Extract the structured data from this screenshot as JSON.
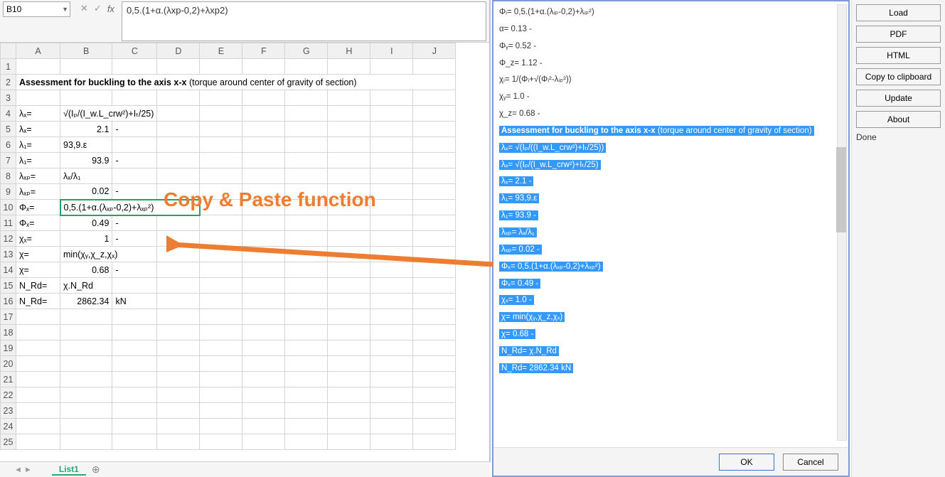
{
  "formula_bar": {
    "name_box": "B10",
    "cancel": "✕",
    "accept": "✓",
    "fx": "fx",
    "formula": "0,5.(1+α.(λxp-0,2)+λxp2)"
  },
  "columns": [
    "A",
    "B",
    "C",
    "D",
    "E",
    "F",
    "G",
    "H",
    "I",
    "J"
  ],
  "rows": {
    "r2": {
      "a": "Assessment for buckling to the axis x-x",
      "a2": " (torque around center of gravity of section)"
    },
    "r4": {
      "a": "λₓ=",
      "b": "√(Iₚ/(I_w.L_crw²)+Iₜ/25)"
    },
    "r5": {
      "a": "λₓ=",
      "b": "2.1",
      "c": "-"
    },
    "r6": {
      "a": "λ₁=",
      "b": "93,9.ε"
    },
    "r7": {
      "a": "λ₁=",
      "b": "93.9",
      "c": "-"
    },
    "r8": {
      "a": "λₓₚ=",
      "b": "λₓ/λ₁"
    },
    "r9": {
      "a": "λₓₚ=",
      "b": "0.02",
      "c": "-"
    },
    "r10": {
      "a": "Φₓ=",
      "b": "0,5.(1+α.(λₓₚ-0,2)+λₓₚ²)"
    },
    "r11": {
      "a": "Φₓ=",
      "b": "0.49",
      "c": "-"
    },
    "r12": {
      "a": "χₓ=",
      "b": "1",
      "c": "-"
    },
    "r13": {
      "a": "χ=",
      "b": "min(χᵧ,χ_z,χₓ)"
    },
    "r14": {
      "a": "χ=",
      "b": "0.68",
      "c": "-"
    },
    "r15": {
      "a": "N_Rd=",
      "b": "χ.N_Rd"
    },
    "r16": {
      "a": "N_Rd=",
      "b": "2862.34",
      "c": "kN"
    }
  },
  "sheet_tab": "List1",
  "annotation": "Copy & Paste function",
  "mid": {
    "plain": [
      "Φᵢ= 0,5.(1+α.(λᵢₚ-0,2)+λᵢₚ²)",
      "α= 0.13 -",
      "Φᵧ= 0.52 -",
      "Φ_z= 1.12 -",
      "χᵢ= 1/(Φᵢ+√(Φᵢ²-λᵢₚ²))",
      "χᵧ= 1.0 -",
      "χ_z= 0.68 -"
    ],
    "title_bold": "Assessment for buckling to the axis x-x",
    "title_rest": " (torque around center of gravity of section)",
    "highlighted": [
      "λₓ= √(Iₚ/((I_w.L_crw²)+Iₜ/25))",
      "λₓ= √(Iₚ/(I_w.L_crw²)+Iₜ/25)",
      "λₓ= 2.1 -",
      "λ₁= 93,9.ε",
      "λ₁= 93.9 -",
      "λₓₚ= λₓ/λ₁",
      "λₓₚ= 0.02 -",
      "Φₓ= 0,5.(1+α.(λₓₚ-0,2)+λₓₚ²)",
      "Φₓ= 0.49 -",
      "χₓ= 1.0 -",
      "χ= min(χᵧ,χ_z,χₓ)",
      "χ= 0.68 -",
      "N_Rd= χ.N_Rd",
      "N_Rd= 2862.34 kN"
    ]
  },
  "mid_buttons": {
    "ok": "OK",
    "cancel": "Cancel"
  },
  "right": {
    "load": "Load",
    "pdf": "PDF",
    "html": "HTML",
    "copy": "Copy to clipboard",
    "update": "Update",
    "about": "About",
    "status": "Done"
  }
}
